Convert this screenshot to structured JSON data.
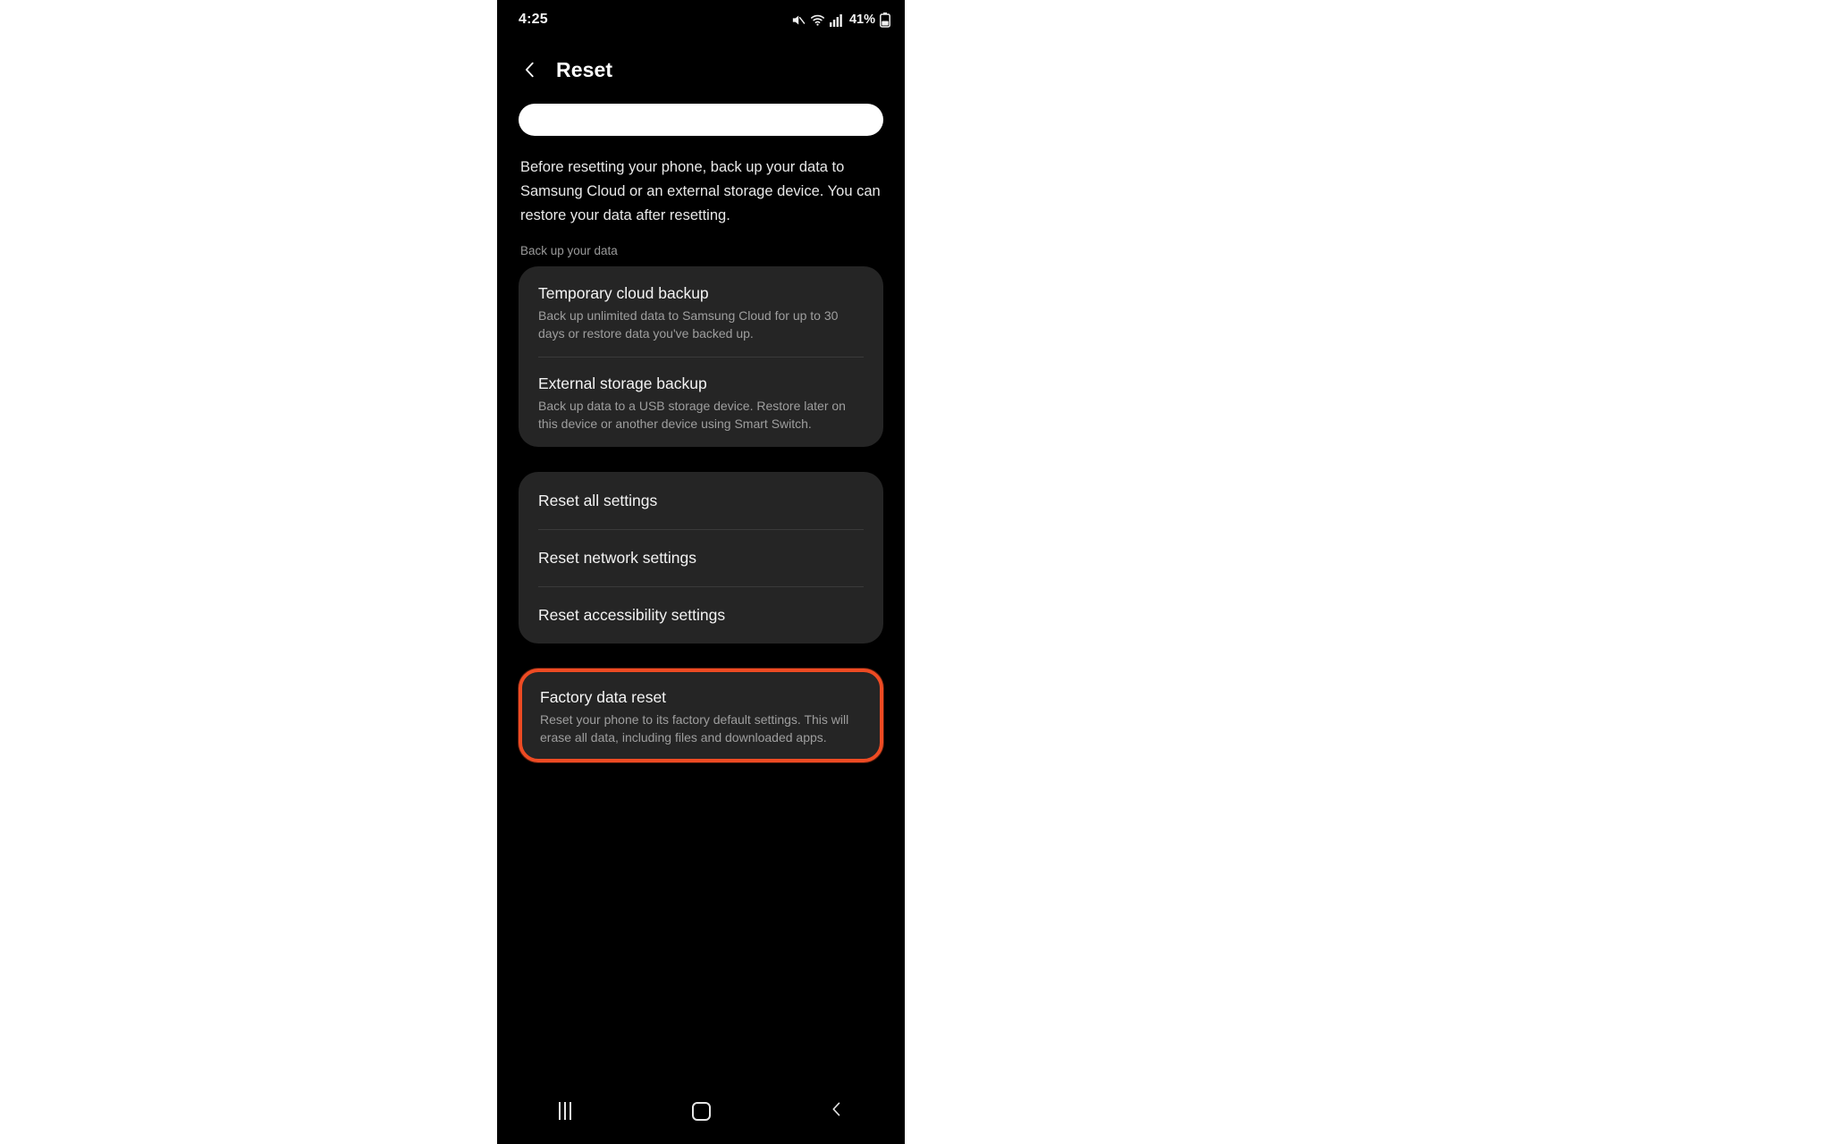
{
  "status_bar": {
    "time": "4:25",
    "battery_percent": "41%",
    "icons": [
      "mute-icon",
      "wifi-icon",
      "cellular-signal-icon",
      "battery-icon"
    ]
  },
  "app_bar": {
    "back_label": "Back",
    "title": "Reset"
  },
  "search": {
    "value": "",
    "placeholder": ""
  },
  "intro": {
    "paragraph": "Before resetting your phone, back up your data to Samsung Cloud or an external storage device. You can restore your data after resetting."
  },
  "sections": [
    {
      "label": "Back up your data",
      "items": [
        {
          "title": "Temporary cloud backup",
          "summary": "Back up unlimited data to Samsung Cloud for up to 30 days or restore data you've backed up."
        },
        {
          "title": "External storage backup",
          "summary": "Back up data to a USB storage device. Restore later on this device or another device using Smart Switch."
        }
      ]
    },
    {
      "label": "",
      "items": [
        {
          "title": "Reset all settings",
          "summary": ""
        },
        {
          "title": "Reset network settings",
          "summary": ""
        },
        {
          "title": "Reset accessibility settings",
          "summary": ""
        }
      ]
    },
    {
      "label": "",
      "highlighted": true,
      "items": [
        {
          "title": "Factory data reset",
          "summary": "Reset your phone to its factory default settings. This will erase all data, including files and downloaded apps."
        }
      ]
    }
  ],
  "nav_bar": {
    "recents_label": "Recents",
    "home_label": "Home",
    "back_label": "Back"
  },
  "colors": {
    "screen_background": "#000000",
    "card_background": "#252525",
    "primary_text": "#f3f3f3",
    "secondary_text": "#9e9e9e",
    "highlight_border": "#ee4b23",
    "page_background": "#ffffff"
  }
}
